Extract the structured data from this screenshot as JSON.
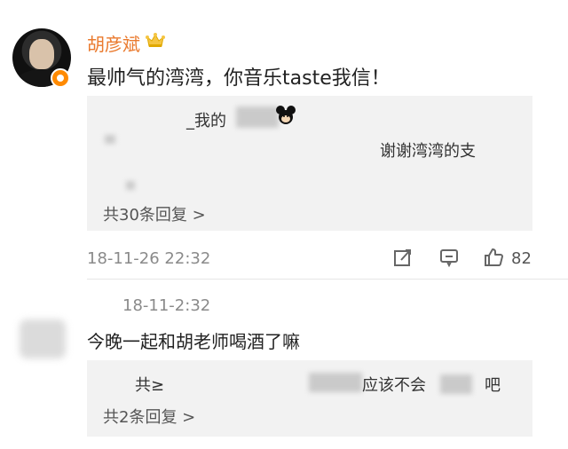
{
  "comment1": {
    "username": "胡彦斌",
    "text": "最帅气的湾湾，你音乐taste我信！",
    "replies_preview": {
      "line1_partial": "_我的",
      "line2_partial": "谢谢湾湾的支",
      "more_replies": "共30条回复 >"
    },
    "time": "18-11-26 22:32",
    "likes": "82"
  },
  "comment2": {
    "time": "18-11-2:32",
    "text": "今晚一起和胡老师喝酒了嘛",
    "replies_preview": {
      "line1_left": "共≥",
      "line1_right": "应该不会",
      "line1_end": "吧",
      "more_replies": "共2条回复 >"
    }
  },
  "icons": {
    "verified_badge": "orange-v-badge-icon",
    "crown": "crown-icon",
    "share": "share-icon",
    "comment": "comment-icon",
    "like": "thumbs-up-icon",
    "sticker": "mickey-sticker-icon"
  },
  "colors": {
    "username": "#ea7a2e",
    "badge": "#ff8a00",
    "reply_bg": "#f2f2f2",
    "muted_text": "#8a8a8a"
  }
}
